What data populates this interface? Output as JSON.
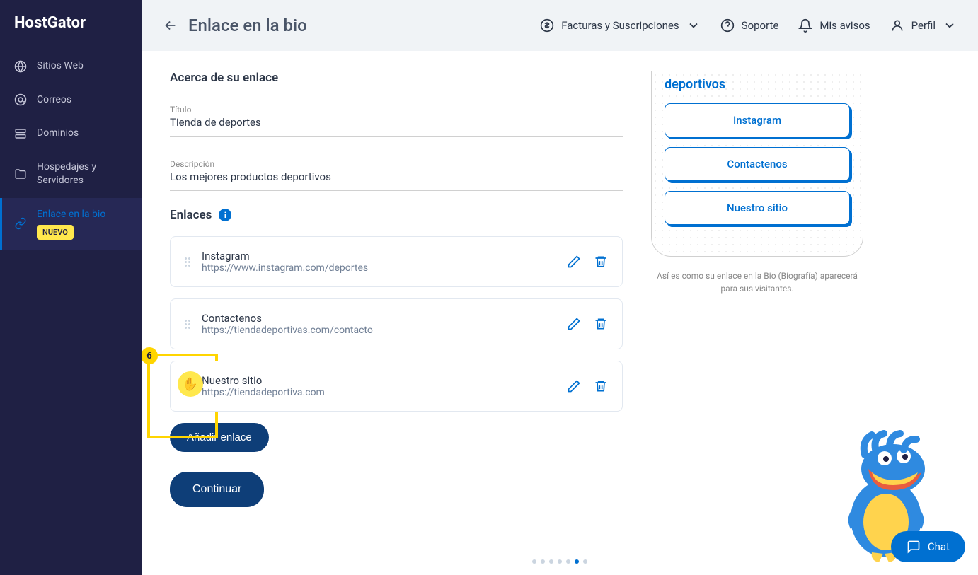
{
  "brand": "HostGator",
  "sidebar": {
    "items": [
      {
        "label": "Sitios Web"
      },
      {
        "label": "Correos"
      },
      {
        "label": "Dominios"
      },
      {
        "label": "Hospedajes y Servidores"
      },
      {
        "label": "Enlace en la bio",
        "badge": "NUEVO"
      }
    ]
  },
  "topbar": {
    "page_title": "Enlace en la bio",
    "billing": "Facturas y Suscripciones",
    "support": "Soporte",
    "notices": "Mis avisos",
    "profile": "Perfil"
  },
  "form": {
    "about_heading": "Acerca de su enlace",
    "title_label": "Título",
    "title_value": "Tienda de deportes",
    "desc_label": "Descripción",
    "desc_value": "Los mejores productos deportivos",
    "links_heading": "Enlaces",
    "links": [
      {
        "name": "Instagram",
        "url": "https://www.instagram.com/deportes"
      },
      {
        "name": "Contactenos",
        "url": "https://tiendadeportivas.com/contacto"
      },
      {
        "name": "Nuestro sitio",
        "url": "https://tiendadeportiva.com"
      }
    ],
    "add_link_label": "Añadir enlace",
    "continue_label": "Continuar"
  },
  "preview": {
    "headline": "deportivos",
    "links": [
      "Instagram",
      "Contactenos",
      "Nuestro sitio"
    ],
    "caption": "Así es como su enlace en la Bio (Biografía) aparecerá para sus visitantes."
  },
  "tour": {
    "step_number": "6"
  },
  "chat_label": "Chat"
}
